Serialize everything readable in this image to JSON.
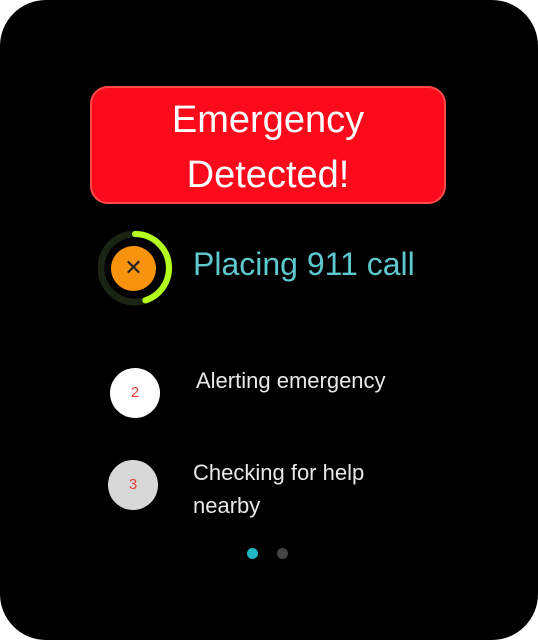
{
  "alert": {
    "line1": "Emergency",
    "line2": "Detected!"
  },
  "call": {
    "status": "Placing 911 call",
    "cancel_icon": "close-icon",
    "cancel_glyph": "✕",
    "countdown_progress": 0.45
  },
  "steps": [
    {
      "number": "2",
      "label": "Alerting emergency"
    },
    {
      "number": "3",
      "label": "Checking for help nearby"
    }
  ],
  "pager": {
    "count": 2,
    "active_index": 0
  },
  "colors": {
    "background": "#000000",
    "alert_red": "#fa0a1a",
    "cancel_orange": "#f7930c",
    "progress_green": "#b4ff1e",
    "status_teal": "#5ec8cf",
    "step_number_red": "#e8403a",
    "pager_active": "#1fb8c4"
  }
}
